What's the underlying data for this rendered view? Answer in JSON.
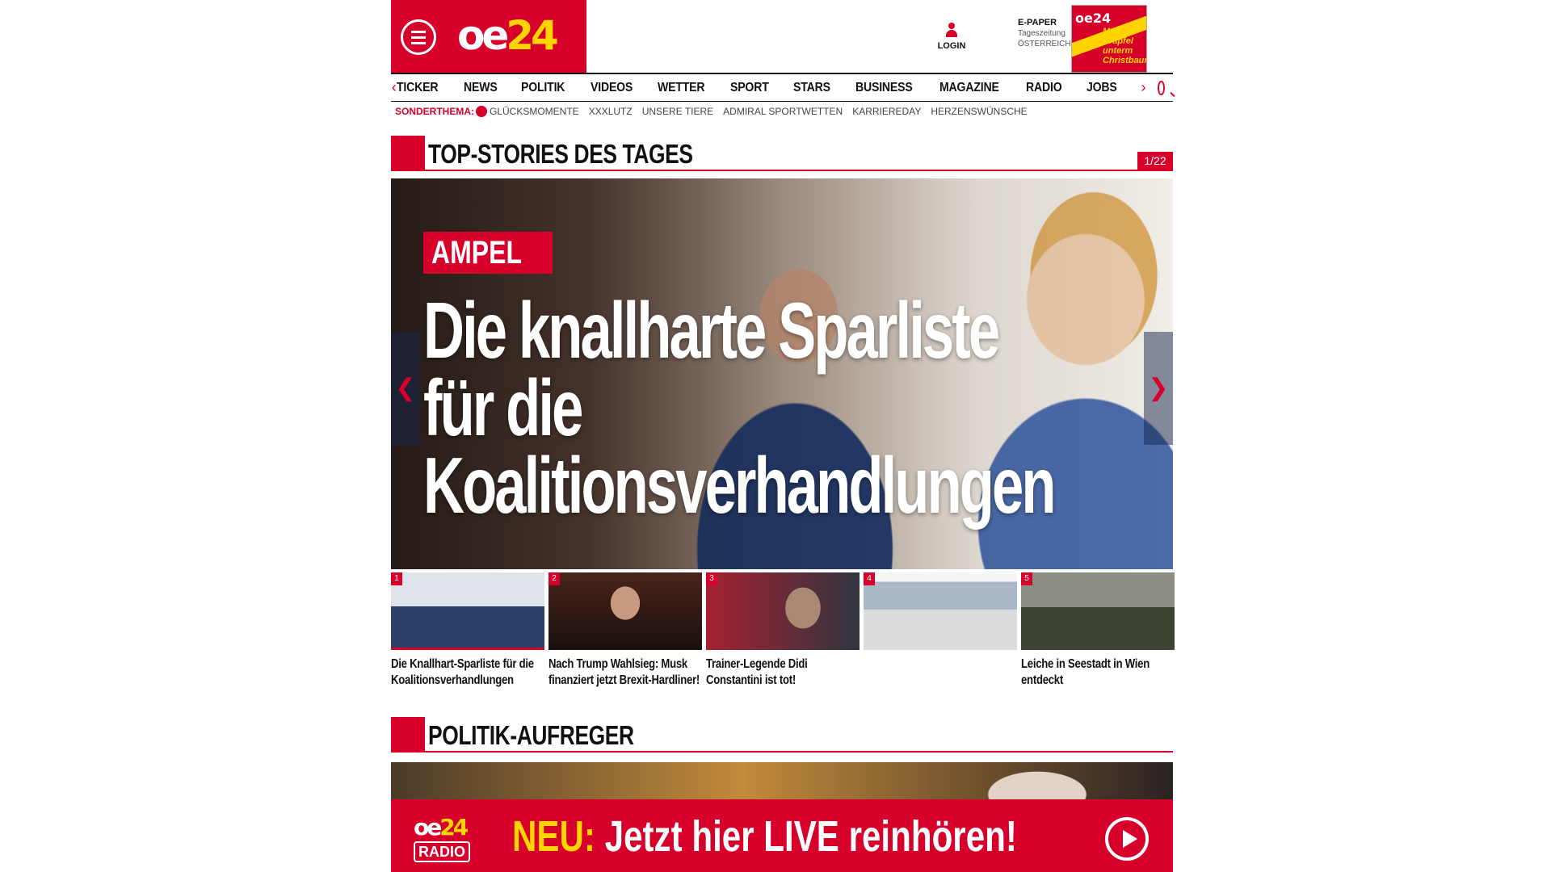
{
  "brand": {
    "logo_part1": "oe",
    "logo_part2": "24"
  },
  "header": {
    "login_label": "LOGIN",
    "epaper": {
      "title": "E-PAPER",
      "line1": "Tageszeitung",
      "line2": "ÖSTERREICH",
      "cover_logo": "oe24",
      "cover_headline": "Meine Krapfel unterm Christbaum"
    }
  },
  "nav": {
    "items": [
      "TICKER",
      "NEWS",
      "POLITIK",
      "VIDEOS",
      "WETTER",
      "SPORT",
      "STARS",
      "BUSINESS",
      "MAGAZINE",
      "RADIO",
      "JOBS"
    ],
    "prev_icon": "chevron-left-icon",
    "next_icon": "chevron-right-icon",
    "search_icon": "search-icon"
  },
  "subnav": {
    "label": "SONDERTHEMA:",
    "items": [
      "GLÜCKSMOMENTE",
      "XXXLUTZ",
      "UNSERE TIERE",
      "ADMIRAL SPORTWETTEN",
      "KARRIEREDAY",
      "HERZENSWÜNSCHE"
    ]
  },
  "topstories": {
    "title": "TOP-STORIES DES TAGES",
    "counter": "1/22",
    "hero": {
      "tag": "AMPEL",
      "headline": "Die knallharte Sparliste für die Koalitionsverhandlungen",
      "prev_glyph": "❮",
      "next_glyph": "❯"
    },
    "items": [
      {
        "num": "1",
        "caption": "Die Knallhart-Sparliste für die Koalitionsverhandlungen"
      },
      {
        "num": "2",
        "caption": "Nach Trump Wahlsieg: Musk finanziert jetzt Brexit-Hardliner!"
      },
      {
        "num": "3",
        "caption": "Trainer-Legende Didi Constantini ist tot!"
      },
      {
        "num": "4",
        "caption": ""
      },
      {
        "num": "5",
        "caption": "Leiche in Seestadt in Wien entdeckt"
      }
    ]
  },
  "politik": {
    "title": "POLITIK-AUFREGER"
  },
  "radio_banner": {
    "logo_top_a": "oe",
    "logo_top_b": "24",
    "logo_bottom": "RADIO",
    "new_label": "NEU:",
    "text": "Jetzt hier LIVE reinhören!",
    "icon": "play-icon"
  },
  "colors": {
    "accent": "#d6002b",
    "brand_yellow": "#ffd400"
  }
}
